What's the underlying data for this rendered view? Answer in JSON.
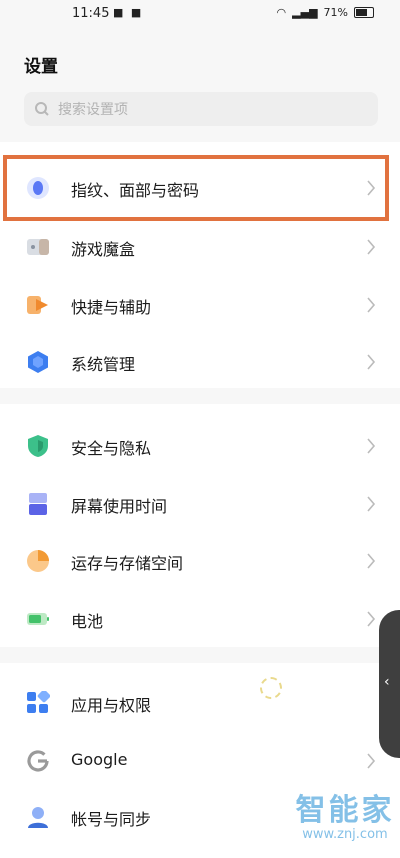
{
  "status_bar": {
    "time": "11:45",
    "battery": "71%"
  },
  "page_title": "设置",
  "search": {
    "placeholder": "搜索设置项"
  },
  "sections": [
    {
      "items": [
        {
          "label": "指纹、面部与密码",
          "icon": "fingerprint-icon",
          "highlighted": true
        },
        {
          "label": "游戏魔盒",
          "icon": "game-box-icon"
        },
        {
          "label": "快捷与辅助",
          "icon": "shortcut-icon"
        },
        {
          "label": "系统管理",
          "icon": "system-management-icon"
        }
      ]
    },
    {
      "items": [
        {
          "label": "安全与隐私",
          "icon": "shield-icon"
        },
        {
          "label": "屏幕使用时间",
          "icon": "screen-time-icon"
        },
        {
          "label": "运存与存储空间",
          "icon": "storage-icon"
        },
        {
          "label": "电池",
          "icon": "battery-icon"
        }
      ]
    },
    {
      "items": [
        {
          "label": "应用与权限",
          "icon": "apps-icon"
        },
        {
          "label": "Google",
          "icon": "google-icon"
        },
        {
          "label": "帐号与同步",
          "icon": "account-icon"
        }
      ]
    }
  ],
  "side_handle": {
    "icon": "chevron-left-icon"
  },
  "watermark": {
    "main": "智能家",
    "sub": "www.znj.com"
  },
  "colors": {
    "highlight": "#e1723f",
    "accent": "#3d7ef0"
  }
}
